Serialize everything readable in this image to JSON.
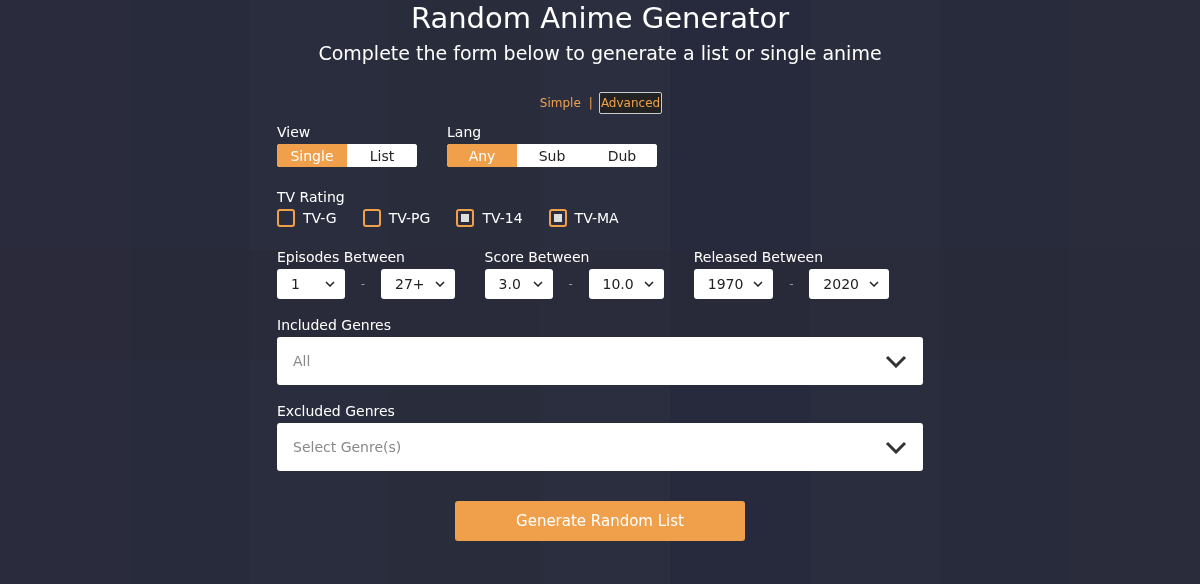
{
  "header": {
    "title": "Random Anime Generator",
    "subtitle": "Complete the form below to generate a list or single anime"
  },
  "mode": {
    "separator": "|",
    "options": [
      {
        "label": "Simple",
        "selected": false
      },
      {
        "label": "Advanced",
        "selected": true
      }
    ]
  },
  "view": {
    "label": "View",
    "options": [
      {
        "label": "Single",
        "selected": true
      },
      {
        "label": "List",
        "selected": false
      }
    ]
  },
  "lang": {
    "label": "Lang",
    "options": [
      {
        "label": "Any",
        "selected": true
      },
      {
        "label": "Sub",
        "selected": false
      },
      {
        "label": "Dub",
        "selected": false
      }
    ]
  },
  "tv_rating": {
    "label": "TV Rating",
    "options": [
      {
        "label": "TV-G",
        "checked": false
      },
      {
        "label": "TV-PG",
        "checked": false
      },
      {
        "label": "TV-14",
        "checked": true
      },
      {
        "label": "TV-MA",
        "checked": true
      }
    ]
  },
  "ranges": [
    {
      "label": "Episodes Between",
      "from": "1",
      "separator": "-",
      "to": "27+"
    },
    {
      "label": "Score Between",
      "from": "3.0",
      "separator": "-",
      "to": "10.0"
    },
    {
      "label": "Released Between",
      "from": "1970",
      "separator": "-",
      "to": "2020"
    }
  ],
  "included_genres": {
    "label": "Included Genres",
    "placeholder": "All"
  },
  "excluded_genres": {
    "label": "Excluded Genres",
    "placeholder": "Select Genre(s)"
  },
  "submit": {
    "label": "Generate Random List"
  }
}
